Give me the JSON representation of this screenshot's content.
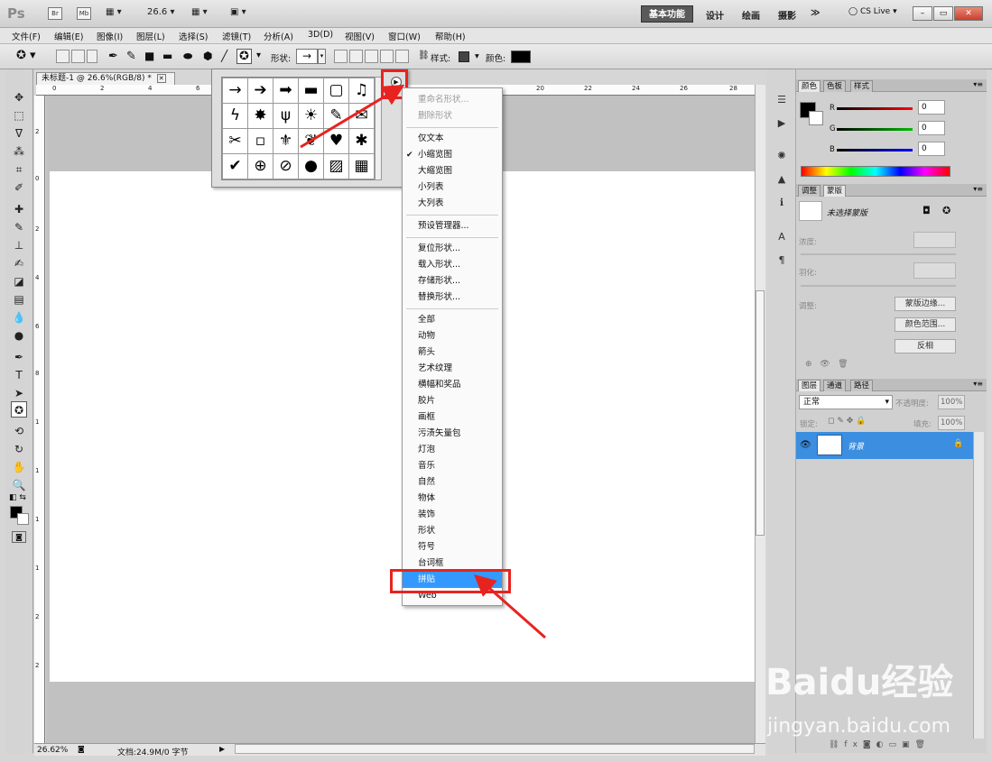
{
  "app": {
    "logo": "Ps",
    "bridge_btn": "Br",
    "minibridge_btn": "Mb",
    "zoom": "26.6",
    "workspaces": {
      "active": "基本功能",
      "others": [
        "设计",
        "绘画",
        "摄影"
      ],
      "more": "≫"
    },
    "cs_live": "CS Live",
    "window_controls": [
      "–",
      "▭",
      "✕"
    ]
  },
  "menu_bar": [
    "文件(F)",
    "编辑(E)",
    "图像(I)",
    "图层(L)",
    "选择(S)",
    "滤镜(T)",
    "分析(A)",
    "3D(D)",
    "视图(V)",
    "窗口(W)",
    "帮助(H)"
  ],
  "options_bar": {
    "shape_label": "形状:",
    "shape_value": "→",
    "style_label": "样式:",
    "color_label": "颜色:",
    "color_value": "#000000"
  },
  "document": {
    "tab_title": "未标题-1 @ 26.6%(RGB/8) *",
    "ruler_top": [
      "0",
      "2",
      "4",
      "6",
      "20",
      "22",
      "24",
      "26",
      "28"
    ],
    "ruler_left": [
      "2",
      "0",
      "2",
      "4",
      "6",
      "8",
      "1",
      "1",
      "1",
      "1",
      "2",
      "2"
    ],
    "status_zoom": "26.62%",
    "status_doc": "文档:24.9M/0 字节"
  },
  "shape_picker": {
    "cells": [
      "→",
      "➔",
      "➡",
      "▬",
      "▢",
      "♫",
      "ϟ",
      "✸",
      "ψ",
      "☀",
      "✎",
      "✉",
      "✂",
      "▫",
      "⚜",
      "❦",
      "♥",
      "✱",
      "✔",
      "⊕",
      "⊘",
      "●",
      "▨",
      "▦"
    ]
  },
  "flyout_menu": {
    "items": [
      {
        "label": "重命名形状...",
        "state": "disabled"
      },
      {
        "label": "删除形状",
        "state": "disabled"
      },
      {
        "sep": true
      },
      {
        "label": "仅文本"
      },
      {
        "label": "小缩览图",
        "checked": true
      },
      {
        "label": "大缩览图"
      },
      {
        "label": "小列表"
      },
      {
        "label": "大列表"
      },
      {
        "sep": true
      },
      {
        "label": "预设管理器..."
      },
      {
        "sep": true
      },
      {
        "label": "复位形状..."
      },
      {
        "label": "载入形状..."
      },
      {
        "label": "存储形状..."
      },
      {
        "label": "替换形状..."
      },
      {
        "sep": true
      },
      {
        "label": "全部"
      },
      {
        "label": "动物"
      },
      {
        "label": "箭头"
      },
      {
        "label": "艺术纹理"
      },
      {
        "label": "横幅和奖品"
      },
      {
        "label": "胶片"
      },
      {
        "label": "画框"
      },
      {
        "label": "污渍矢量包"
      },
      {
        "label": "灯泡"
      },
      {
        "label": "音乐"
      },
      {
        "label": "自然"
      },
      {
        "label": "物体"
      },
      {
        "label": "装饰"
      },
      {
        "label": "形状"
      },
      {
        "label": "符号"
      },
      {
        "label": "台词框"
      },
      {
        "label": "拼贴",
        "state": "selected"
      },
      {
        "label": "Web"
      }
    ]
  },
  "panels": {
    "color_tabs": [
      "颜色",
      "色板",
      "样式"
    ],
    "channels": [
      {
        "label": "R",
        "value": "0",
        "color": "#d01010"
      },
      {
        "label": "G",
        "value": "0",
        "color": "#10a010"
      },
      {
        "label": "B",
        "value": "0",
        "color": "#1010d0"
      }
    ],
    "adjust_tabs": [
      "调整",
      "蒙版"
    ],
    "mask_label": "未选择蒙版",
    "density_label": "浓度:",
    "feather_label": "羽化:",
    "refine_label": "调整:",
    "mask_edge_btn": "蒙版边缘...",
    "color_range_btn": "颜色范围...",
    "invert_btn": "反相",
    "layer_tabs": [
      "图层",
      "通道",
      "路径"
    ],
    "blend_mode": "正常",
    "opacity_label": "不透明度:",
    "opacity_value": "100%",
    "lock_label": "锁定:",
    "fill_label": "填充:",
    "fill_value": "100%",
    "layer_name": "背景"
  },
  "watermark": {
    "main": "Baidu经验",
    "sub": "jingyan.baidu.com"
  }
}
